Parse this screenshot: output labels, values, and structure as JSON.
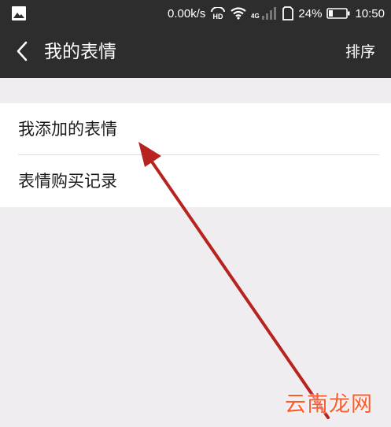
{
  "status_bar": {
    "network_speed": "0.00k/s",
    "hd_badge": "HD",
    "network_type": "4G",
    "battery_percent": "24%",
    "battery_level": 0.24,
    "time": "10:50"
  },
  "nav": {
    "title": "我的表情",
    "right_action": "排序"
  },
  "list": {
    "items": [
      {
        "label": "我添加的表情"
      },
      {
        "label": "表情购买记录"
      }
    ]
  },
  "annotation": {
    "arrow_color": "#b7231e"
  },
  "watermark": {
    "text": "云南龙网"
  },
  "colors": {
    "header_bg": "#2d2d2d",
    "page_bg": "#efedf0",
    "list_bg": "#ffffff",
    "divider": "#dcdcdc"
  }
}
